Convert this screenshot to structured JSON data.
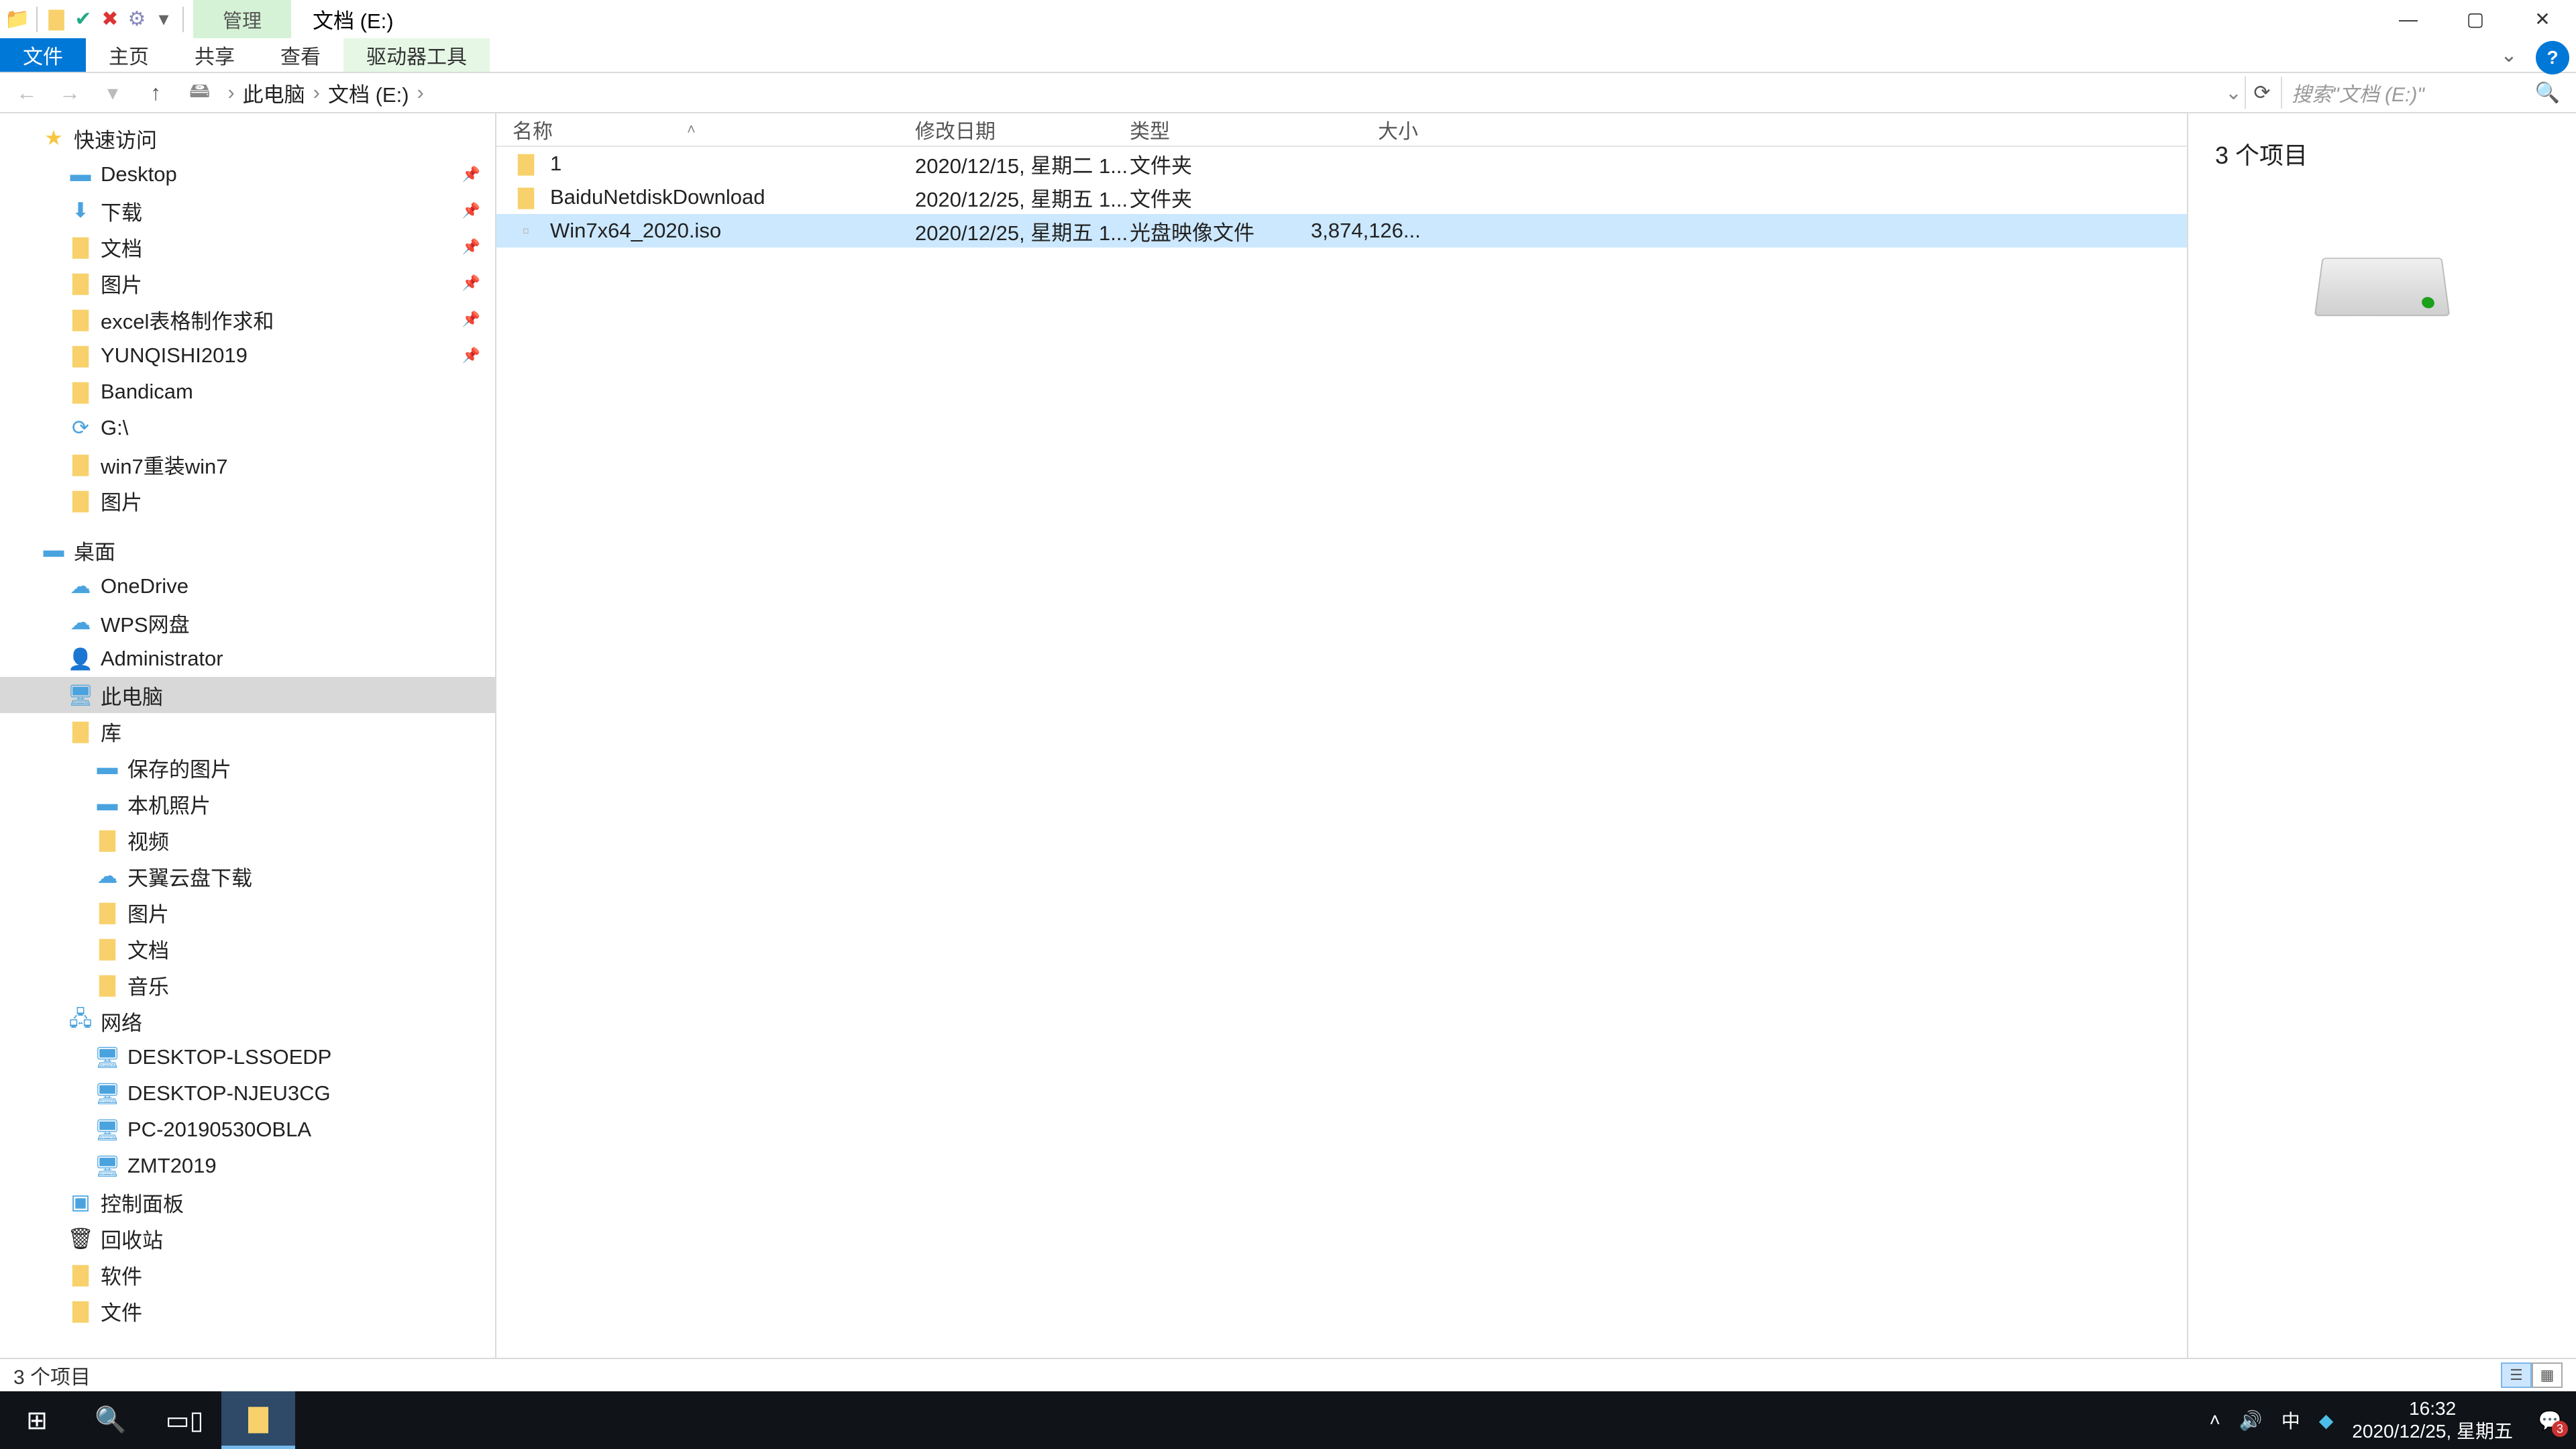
{
  "titlebar": {
    "management": "管理",
    "title": "文档 (E:)"
  },
  "ribbon": {
    "file": "文件",
    "home": "主页",
    "share": "共享",
    "view": "查看",
    "drive_tools": "驱动器工具"
  },
  "breadcrumb": {
    "this_pc": "此电脑",
    "drive": "文档 (E:)"
  },
  "search": {
    "placeholder": "搜索\"文档 (E:)\""
  },
  "navtree": {
    "quick_access": "快速访问",
    "desktop": "Desktop",
    "downloads": "下载",
    "documents": "文档",
    "pictures": "图片",
    "excel": "excel表格制作求和",
    "yunqishi": "YUNQISHI2019",
    "bandicam": "Bandicam",
    "gdrive": "G:\\",
    "win7reinstall": "win7重装win7",
    "pictures2": "图片",
    "desktop_cn": "桌面",
    "onedrive": "OneDrive",
    "wps": "WPS网盘",
    "admin": "Administrator",
    "this_pc": "此电脑",
    "library": "库",
    "saved_pics": "保存的图片",
    "local_photos": "本机照片",
    "videos": "视频",
    "tianyi": "天翼云盘下载",
    "libpics": "图片",
    "libdocs": "文档",
    "music": "音乐",
    "network": "网络",
    "pc1": "DESKTOP-LSSOEDP",
    "pc2": "DESKTOP-NJEU3CG",
    "pc3": "PC-20190530OBLA",
    "pc4": "ZMT2019",
    "control_panel": "控制面板",
    "recycle": "回收站",
    "software": "软件",
    "files": "文件"
  },
  "columns": {
    "name": "名称",
    "date": "修改日期",
    "type": "类型",
    "size": "大小"
  },
  "files": [
    {
      "name": "1",
      "date": "2020/12/15, 星期二 1...",
      "type": "文件夹",
      "size": "",
      "icon": "folder"
    },
    {
      "name": "BaiduNetdiskDownload",
      "date": "2020/12/25, 星期五 1...",
      "type": "文件夹",
      "size": "",
      "icon": "folder"
    },
    {
      "name": "Win7x64_2020.iso",
      "date": "2020/12/25, 星期五 1...",
      "type": "光盘映像文件",
      "size": "3,874,126...",
      "icon": "file",
      "selected": true
    }
  ],
  "preview": {
    "count": "3 个项目"
  },
  "statusbar": {
    "text": "3 个项目"
  },
  "taskbar": {
    "time": "16:32",
    "date": "2020/12/25, 星期五",
    "ime": "中",
    "notif_count": "3"
  }
}
